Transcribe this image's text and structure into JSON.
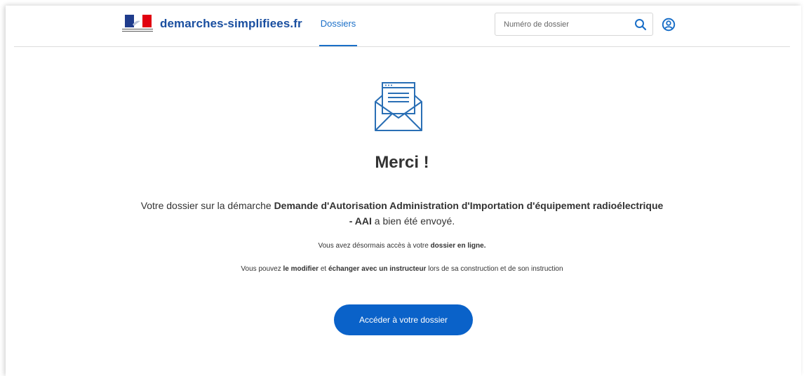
{
  "header": {
    "brand": "demarches-simplifiees.fr",
    "tab_dossiers": "Dossiers",
    "search_placeholder": "Numéro de dossier",
    "icons": {
      "search": "search-icon",
      "user": "user-account-icon",
      "flag": "french-republic-flag-icon"
    },
    "colors": {
      "brand": "#1a4fa0",
      "accent": "#1a6fc8"
    }
  },
  "main": {
    "title": "Merci !",
    "lead": {
      "prefix": "Votre dossier sur la démarche ",
      "procedure": "Demande d'Autorisation Administration d'Importation d'équipement radioélectrique - AAI",
      "suffix": " a bien été envoyé."
    },
    "note1": {
      "prefix": "Vous avez désormais accès à votre ",
      "strong": "dossier en ligne."
    },
    "note2": {
      "p1": "Vous pouvez ",
      "s1": "le modifier",
      "p2": " et ",
      "s2": "échanger avec un instructeur",
      "p3": " lors de sa construction et de son instruction"
    },
    "cta_label": "Accéder à votre dossier",
    "icons": {
      "envelope": "envelope-icon"
    },
    "colors": {
      "cta": "#0a62c9"
    }
  }
}
